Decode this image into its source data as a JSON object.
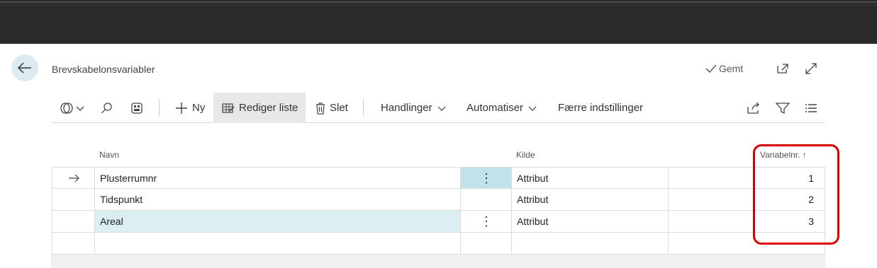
{
  "header": {
    "title": "Brevskabelonsvariabler",
    "saved_label": "Gemt"
  },
  "actionbar": {
    "new_label": "Ny",
    "edit_list_label": "Rediger liste",
    "delete_label": "Slet",
    "actions_label": "Handlinger",
    "automate_label": "Automatiser",
    "fewer_options_label": "Færre indstillinger"
  },
  "columns": {
    "name": "Navn",
    "source": "Kilde",
    "var_no": "Variabelnr.",
    "sort_indicator": "↑"
  },
  "rows": [
    {
      "name": "Plusterrumnr",
      "source": "Attribut",
      "var_no": "1"
    },
    {
      "name": "Tidspunkt",
      "source": "Attribut",
      "var_no": "2"
    },
    {
      "name": "Areal",
      "source": "Attribut",
      "var_no": "3"
    }
  ],
  "colors": {
    "accent_row": "#dbeef2",
    "annotation": "#d90000"
  }
}
